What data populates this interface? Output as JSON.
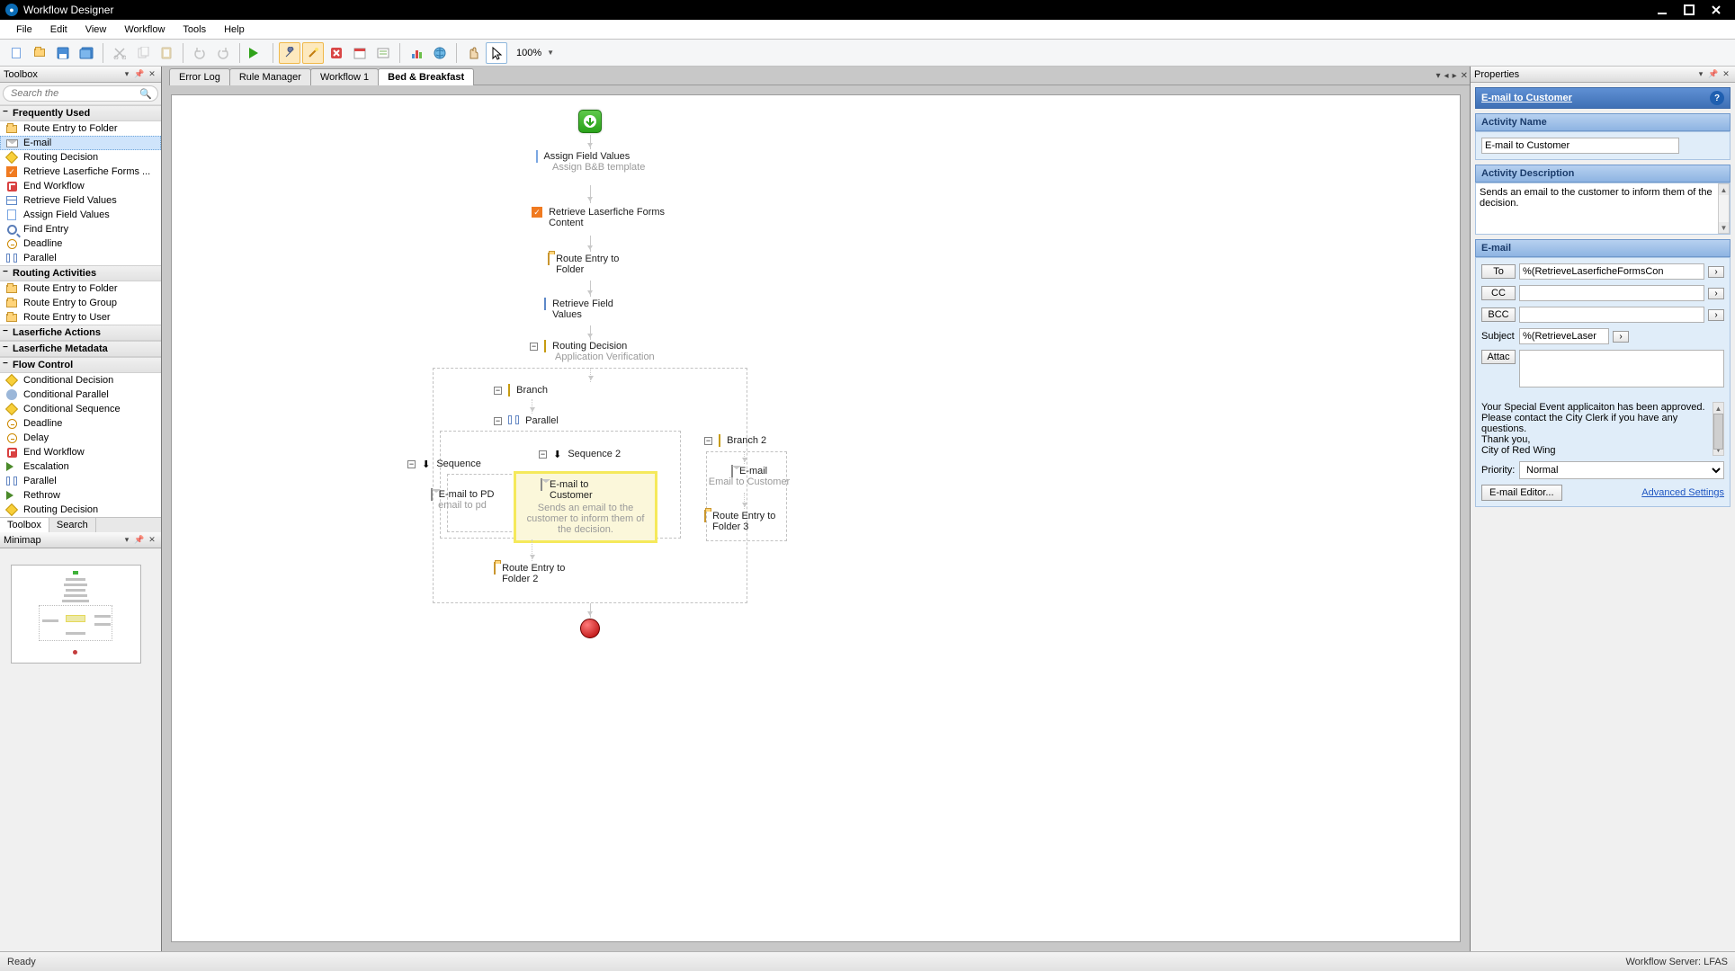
{
  "window": {
    "title": "Workflow Designer"
  },
  "menus": [
    "File",
    "Edit",
    "View",
    "Workflow",
    "Tools",
    "Help"
  ],
  "zoom": "100%",
  "tabs": [
    {
      "label": "Error Log",
      "active": false
    },
    {
      "label": "Rule Manager",
      "active": false
    },
    {
      "label": "Workflow 1",
      "active": false
    },
    {
      "label": "Bed & Breakfast",
      "active": true
    }
  ],
  "toolbox": {
    "title": "Toolbox",
    "search_placeholder": "Search the",
    "bottom_tabs": [
      "Toolbox",
      "Search"
    ],
    "groups": [
      {
        "name": "Frequently Used",
        "items": [
          {
            "label": "Route Entry to Folder",
            "icon": "folder"
          },
          {
            "label": "E-mail",
            "icon": "mail",
            "selected": true
          },
          {
            "label": "Routing Decision",
            "icon": "diamond"
          },
          {
            "label": "Retrieve Laserfiche Forms ...",
            "icon": "checkbox"
          },
          {
            "label": "End Workflow",
            "icon": "stop"
          },
          {
            "label": "Retrieve Field Values",
            "icon": "table"
          },
          {
            "label": "Assign Field Values",
            "icon": "doc"
          },
          {
            "label": "Find Entry",
            "icon": "find"
          },
          {
            "label": "Deadline",
            "icon": "clock"
          },
          {
            "label": "Parallel",
            "icon": "para"
          }
        ]
      },
      {
        "name": "Routing Activities",
        "items": [
          {
            "label": "Route Entry to Folder",
            "icon": "folder"
          },
          {
            "label": "Route Entry to Group",
            "icon": "folder"
          },
          {
            "label": "Route Entry to User",
            "icon": "folder"
          }
        ]
      },
      {
        "name": "Laserfiche Actions",
        "items": []
      },
      {
        "name": "Laserfiche Metadata",
        "items": []
      },
      {
        "name": "Flow Control",
        "items": [
          {
            "label": "Conditional Decision",
            "icon": "diamond"
          },
          {
            "label": "Conditional Parallel",
            "icon": "gear"
          },
          {
            "label": "Conditional Sequence",
            "icon": "diamond"
          },
          {
            "label": "Deadline",
            "icon": "clock"
          },
          {
            "label": "Delay",
            "icon": "clock"
          },
          {
            "label": "End Workflow",
            "icon": "stop"
          },
          {
            "label": "Escalation",
            "icon": "arrowr"
          },
          {
            "label": "Parallel",
            "icon": "para"
          },
          {
            "label": "Rethrow",
            "icon": "arrowr"
          },
          {
            "label": "Routing Decision",
            "icon": "diamond"
          }
        ]
      }
    ]
  },
  "minimap": {
    "title": "Minimap"
  },
  "workflow": {
    "nodes": {
      "assign": {
        "title": "Assign Field Values",
        "sub": "Assign B&B template"
      },
      "retrieveForms": {
        "title": "Retrieve Laserfiche Forms Content"
      },
      "routeFolder": {
        "title": "Route Entry to Folder"
      },
      "retrieveFields": {
        "title": "Retrieve Field Values"
      },
      "routing": {
        "title": "Routing Decision",
        "sub": "Application Verification"
      },
      "branch": {
        "title": "Branch"
      },
      "parallel": {
        "title": "Parallel"
      },
      "sequence": {
        "title": "Sequence"
      },
      "sequence2": {
        "title": "Sequence 2"
      },
      "emailPD": {
        "title": "E-mail to PD",
        "sub": "email to pd"
      },
      "emailCustomer": {
        "title": "E-mail to Customer",
        "sub": "Sends an email to the customer to inform them of the decision."
      },
      "branch2": {
        "title": "Branch 2"
      },
      "email2": {
        "title": "E-mail",
        "sub": "Email to Customer"
      },
      "routeFolder2": {
        "title": "Route Entry to Folder 2"
      },
      "routeFolder3": {
        "title": "Route Entry to Folder 3"
      }
    }
  },
  "properties": {
    "title": "Properties",
    "entity": "E-mail to Customer",
    "sections": {
      "activityName": {
        "header": "Activity Name",
        "value": "E-mail to Customer"
      },
      "activityDesc": {
        "header": "Activity Description",
        "value": "Sends an email to the customer to inform them of the decision."
      },
      "email": {
        "header": "E-mail",
        "to_label": "To",
        "to_value": "%(RetrieveLaserficheFormsCon",
        "cc_label": "CC",
        "cc_value": "",
        "bcc_label": "BCC",
        "bcc_value": "",
        "subject_label": "Subject",
        "subject_value": "%(RetrieveLaser",
        "attach_label": "Attac",
        "body": "Your Special Event applicaiton has been approved. Please contact the City Clerk if you have any questions.\nThank you,\nCity of Red Wing",
        "priority_label": "Priority:",
        "priority_value": "Normal",
        "editor_btn": "E-mail Editor...",
        "advanced": "Advanced Settings"
      }
    }
  },
  "status": {
    "left": "Ready",
    "right": "Workflow Server: LFAS"
  }
}
